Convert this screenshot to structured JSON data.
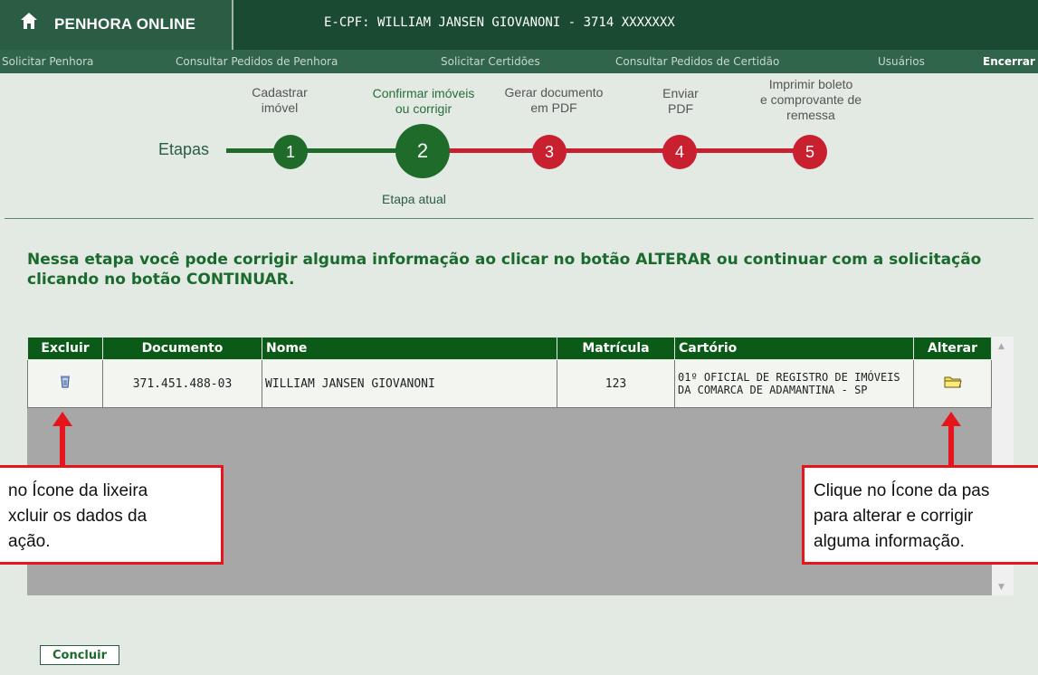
{
  "header": {
    "app_title": "PENHORA ONLINE",
    "ecpf_label": "E-CPF: WILLIAM JANSEN GIOVANONI - 3714 XXXXXXX"
  },
  "nav": {
    "items": [
      {
        "label": "Solicitar Penhora"
      },
      {
        "label": "Consultar Pedidos de Penhora"
      },
      {
        "label": "Solicitar Certidões"
      },
      {
        "label": "Consultar Pedidos de Certidão"
      },
      {
        "label": "Usuários"
      },
      {
        "label": "Encerrar"
      }
    ]
  },
  "steps": {
    "label": "Etapas",
    "current_label": "Etapa atual",
    "items": [
      {
        "number": "1",
        "title": "Cadastrar\nimóvel",
        "status": "done"
      },
      {
        "number": "2",
        "title": "Confirmar imóveis\nou corrigir",
        "status": "current"
      },
      {
        "number": "3",
        "title": "Gerar documento\nem PDF",
        "status": "pending"
      },
      {
        "number": "4",
        "title": "Enviar\nPDF",
        "status": "pending"
      },
      {
        "number": "5",
        "title": "Imprimir boleto\ne comprovante de\nremessa",
        "status": "pending"
      }
    ]
  },
  "instructions": "Nessa etapa você pode corrigir alguma informação ao clicar no botão ALTERAR ou continuar com a solicitação clicando no botão CONTINUAR.",
  "table": {
    "headers": {
      "excluir": "Excluir",
      "documento": "Documento",
      "nome": "Nome",
      "matricula": "Matrícula",
      "cartorio": "Cartório",
      "alterar": "Alterar"
    },
    "rows": [
      {
        "documento": "371.451.488-03",
        "nome": "WILLIAM JANSEN GIOVANONI",
        "matricula": "123",
        "cartorio": "01º OFICIAL DE REGISTRO DE IMÓVEIS DA COMARCA DE ADAMANTINA - SP"
      }
    ]
  },
  "callouts": {
    "left": "no Ícone da lixeira\nxcluir os dados da\nação.",
    "right": "Clique no Ícone da pas\npara alterar e corrigir\nalguma informação."
  },
  "buttons": {
    "concluir": "Concluir"
  },
  "colors": {
    "header_dark": "#1b4a32",
    "nav_green": "#31654b",
    "step_done": "#1f6b2a",
    "step_pending": "#c8202f",
    "table_header": "#0c5a17",
    "callout_red": "#e8141c"
  }
}
